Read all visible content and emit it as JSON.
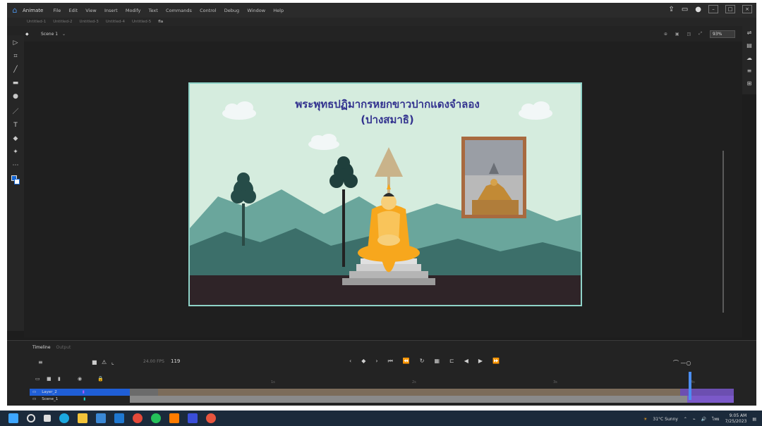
{
  "app": {
    "name": "Animate"
  },
  "menu": [
    "File",
    "Edit",
    "View",
    "Insert",
    "Modify",
    "Text",
    "Commands",
    "Control",
    "Debug",
    "Window",
    "Help"
  ],
  "doc_tabs": [
    "Untitled-1",
    "Untitled-2",
    "Untitled-3",
    "Untitled-4",
    "Untitled-5",
    "fla"
  ],
  "scene": {
    "label": "Scene 1"
  },
  "zoom": {
    "value": "93%"
  },
  "canvas": {
    "title_line1": "พระพุทธปฏิมากรหยกขาวปากแดงจำลอง",
    "title_line2": "(ปางสมาธิ)"
  },
  "timeline": {
    "tab_active": "Timeline",
    "tab_inactive": "Output",
    "fps": "24.00 FPS",
    "current_frame": "119",
    "ruler": [
      "1s",
      "2s",
      "3s",
      "4s",
      "5s"
    ],
    "layers": [
      {
        "name": "Layer_2",
        "selected": true
      },
      {
        "name": "Scene_1",
        "selected": false
      }
    ]
  },
  "taskbar": {
    "weather": "31°C  Sunny",
    "lang": "ไทย",
    "time": "9:05 AM",
    "date": "7/25/2023"
  },
  "colors": {
    "sky": "#d5ecde",
    "title": "#33338f",
    "robe": "#f7a71d",
    "mountain_dark": "#3c6f6a",
    "mountain_light": "#6aa69c",
    "ground": "#2f2428",
    "selection": "#1f5ed6"
  }
}
